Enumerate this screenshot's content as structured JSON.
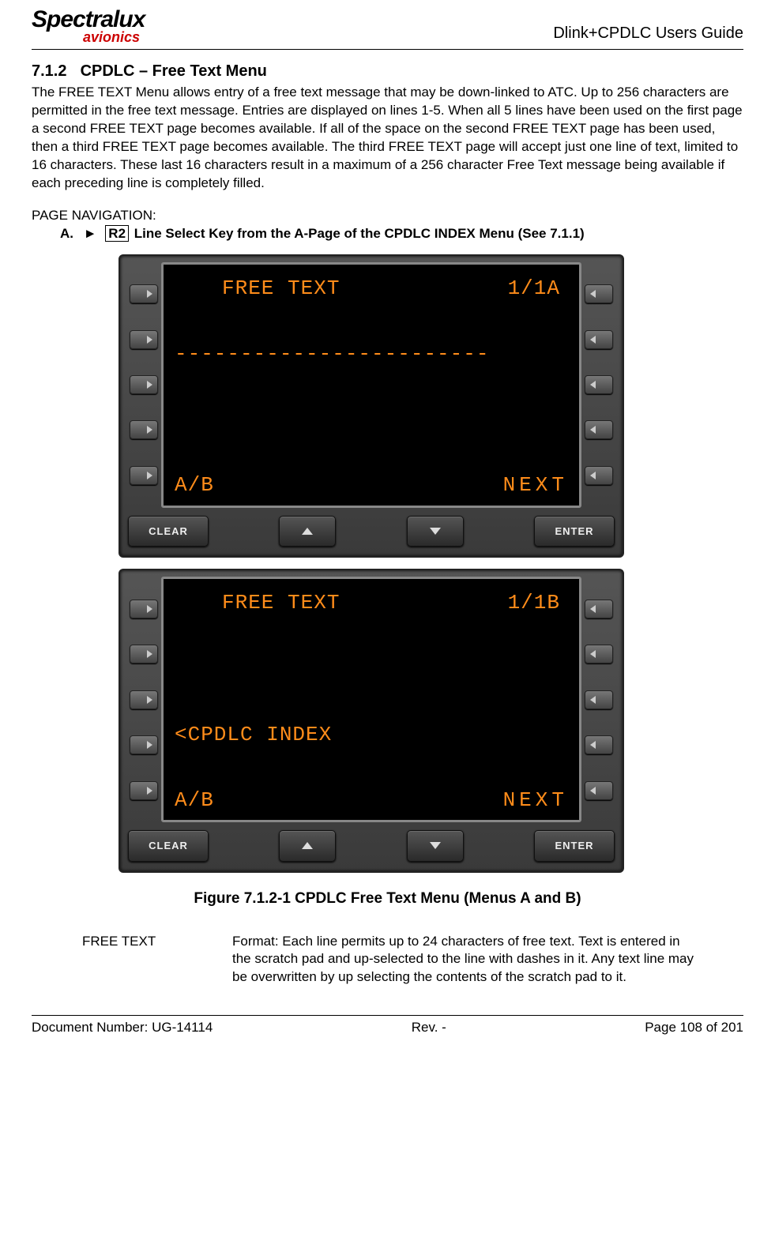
{
  "header": {
    "logo_main": "Spectralux",
    "logo_sub": "avionics",
    "doc_title": "Dlink+CPDLC Users Guide"
  },
  "section": {
    "number": "7.1.2",
    "title": "CPDLC – Free Text Menu",
    "body": "The FREE TEXT Menu allows entry of a free text message that may be down-linked to ATC. Up to 256 characters are permitted in the free text message.  Entries are displayed on lines 1-5.  When all 5 lines have been used on the first page a second FREE TEXT page becomes available.  If all of the space on the second FREE TEXT page has been used, then a third FREE TEXT page becomes available.  The third FREE TEXT page will accept just one line of text, limited to 16 characters.  These last 16 characters result in a maximum of a 256 character Free Text message being available if each preceding line is completely filled."
  },
  "nav": {
    "label": "PAGE NAVIGATION:",
    "item_letter": "A.",
    "arrow": "►",
    "key": "R2",
    "rest": "Line Select Key from the A-Page of the CPDLC INDEX Menu (See 7.1.1)"
  },
  "cdu_a": {
    "title": "FREE TEXT",
    "page": "1/1A",
    "dashes": "------------------------",
    "ab": "A/B",
    "next": "NEXT",
    "clear": "CLEAR",
    "enter": "ENTER"
  },
  "cdu_b": {
    "title": "FREE TEXT",
    "page": "1/1B",
    "cpdlc": "<CPDLC INDEX",
    "ab": "A/B",
    "next": "NEXT",
    "clear": "CLEAR",
    "enter": "ENTER"
  },
  "figure_caption": "Figure 7.1.2-1 CPDLC Free Text Menu (Menus A and B)",
  "definition": {
    "term": "FREE TEXT",
    "desc": "Format: Each line permits up to 24 characters of free text. Text is entered in the scratch pad and up-selected to the line with dashes in it. Any text line may be overwritten by up selecting the contents of the scratch pad to it."
  },
  "footer": {
    "doc_num": "Document Number:  UG-14114",
    "rev": "Rev. -",
    "page": "Page 108 of 201"
  }
}
